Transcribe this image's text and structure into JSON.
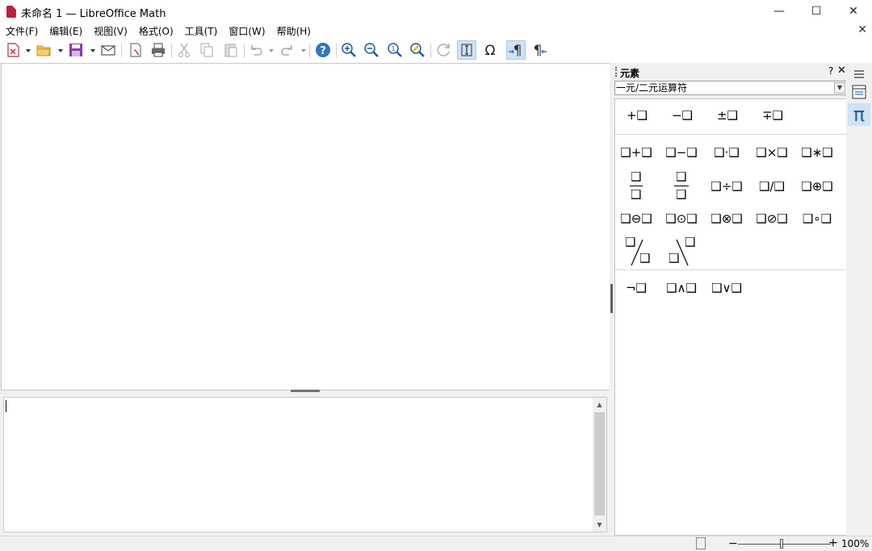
{
  "window": {
    "title": "未命名 1 — LibreOffice Math",
    "minimize": "—",
    "maximize": "☐",
    "close": "✕"
  },
  "menu": [
    "文件(F)",
    "编辑(E)",
    "视图(V)",
    "格式(O)",
    "工具(T)",
    "窗口(W)",
    "帮助(H)"
  ],
  "doc_close": "✕",
  "panel": {
    "title": "元素",
    "help": "?",
    "close": "✕",
    "category_selected": "一元/二元运算符",
    "unary": [
      "+❑",
      "−❑",
      "±❑",
      "∓❑"
    ],
    "binary_row1": [
      "❑+❑",
      "❑−❑",
      "❑·❑",
      "❑×❑",
      "❑∗❑"
    ],
    "binary_row2": [
      "❑÷❑",
      "❑/❑",
      "❑⊕❑"
    ],
    "binary_row3": [
      "❑⊖❑",
      "❑⊙❑",
      "❑⊗❑",
      "❑⊘❑",
      "❑∘❑"
    ],
    "logic": [
      "¬❑",
      "❑∧❑",
      "❑∨❑"
    ],
    "box": "❑"
  },
  "deck": {
    "properties_icon": "properties-icon",
    "elements_icon": "pi-icon",
    "pi": "π"
  },
  "status": {
    "zoom": "100%",
    "minus": "−",
    "plus": "+"
  },
  "icons": {
    "accent": "#2e74c7",
    "active_bg": "#cfe2f6"
  }
}
